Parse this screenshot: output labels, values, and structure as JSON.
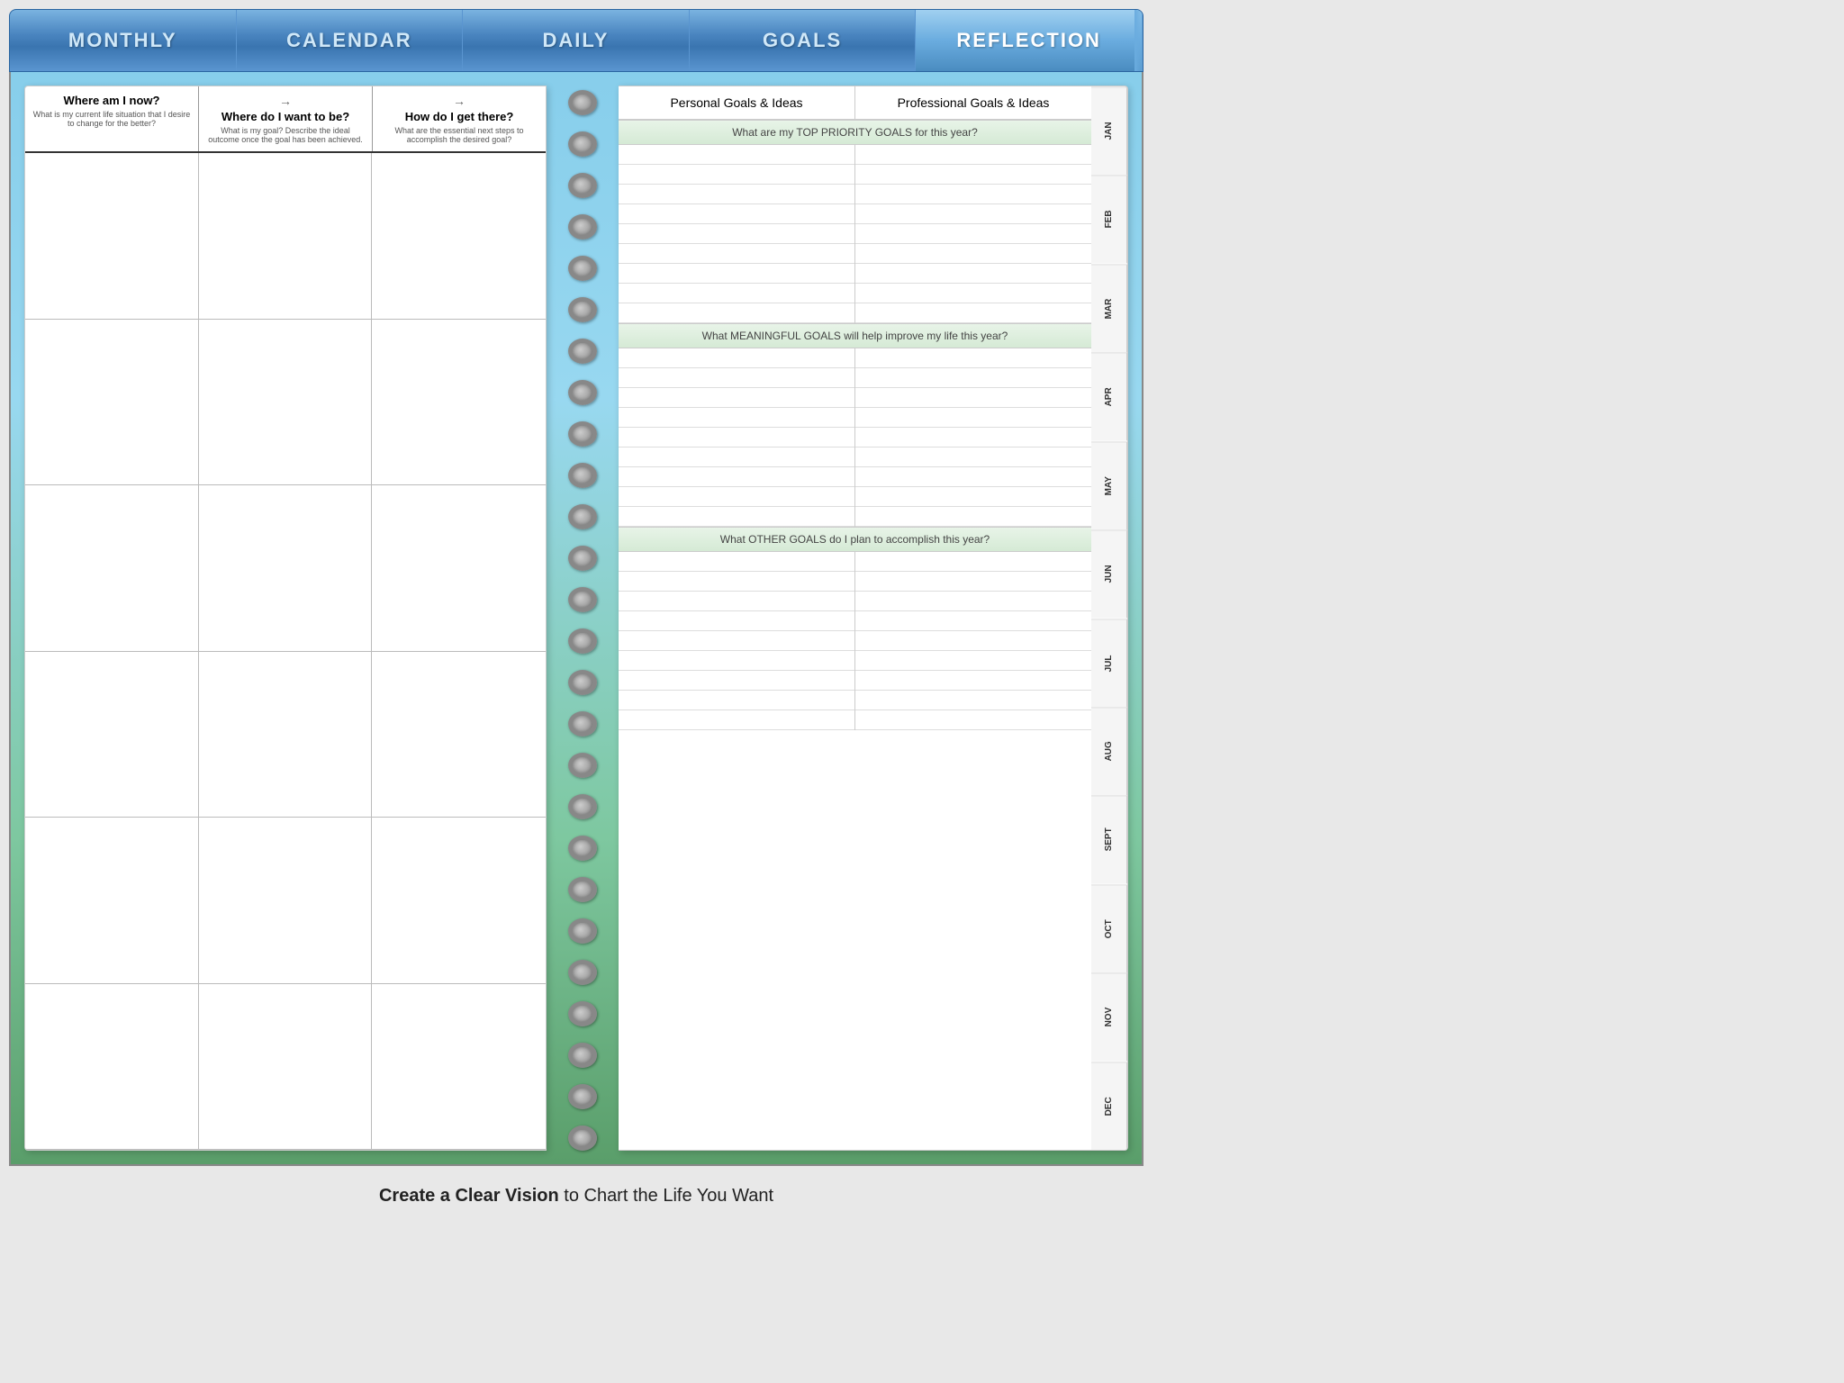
{
  "nav": {
    "items": [
      {
        "label": "MONTHLY",
        "active": false
      },
      {
        "label": "CALENDAR",
        "active": false
      },
      {
        "label": "DAILY",
        "active": false
      },
      {
        "label": "GOALS",
        "active": false
      },
      {
        "label": "REFLECTION",
        "active": true
      }
    ]
  },
  "left_page": {
    "columns": [
      {
        "title": "Where am I now?",
        "subtitle": "What is my current life situation that I desire to change for the better?",
        "arrow": true
      },
      {
        "title": "Where do I want to be?",
        "subtitle": "What is my goal? Describe the ideal outcome once the goal has been achieved.",
        "arrow": true
      },
      {
        "title": "How do I get there?",
        "subtitle": "What are the essential next steps to accomplish the desired goal?"
      }
    ],
    "rows": 6
  },
  "right_page": {
    "columns": [
      {
        "label": "Personal Goals & Ideas"
      },
      {
        "label": "Professional Goals & Ideas"
      }
    ],
    "sections": [
      {
        "label": "What are my TOP PRIORITY GOALS for this year?",
        "lines": 9
      },
      {
        "label": "What MEANINGFUL GOALS will help improve my life this year?",
        "lines": 9
      },
      {
        "label": "What OTHER GOALS do I plan to accomplish this year?",
        "lines": 9
      }
    ]
  },
  "months": [
    "JAN",
    "FEB",
    "MAR",
    "APR",
    "MAY",
    "JUN",
    "JUL",
    "AUG",
    "SEPT",
    "OCT",
    "NOV",
    "DEC"
  ],
  "tagline": {
    "bold": "Create a Clear Vision",
    "rest": " to Chart the Life You Want"
  },
  "spiral": {
    "count": 26
  }
}
